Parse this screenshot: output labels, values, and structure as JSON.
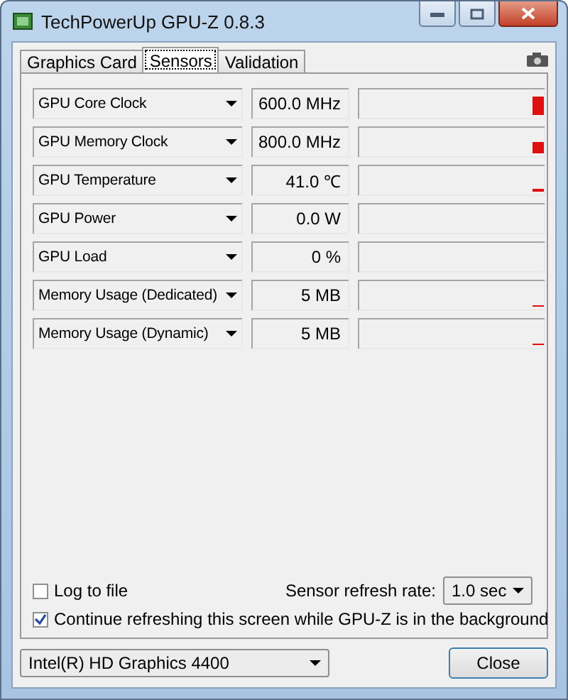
{
  "window": {
    "title": "TechPowerUp GPU-Z 0.8.3"
  },
  "tabs": [
    {
      "label": "Graphics Card",
      "selected": false
    },
    {
      "label": "Sensors",
      "selected": true
    },
    {
      "label": "Validation",
      "selected": false
    }
  ],
  "sensors": [
    {
      "name": "GPU Core Clock",
      "value": "600.0 MHz"
    },
    {
      "name": "GPU Memory Clock",
      "value": "800.0 MHz"
    },
    {
      "name": "GPU Temperature",
      "value": "41.0 ℃"
    },
    {
      "name": "GPU Power",
      "value": "0.0 W"
    },
    {
      "name": "GPU Load",
      "value": "0 %"
    },
    {
      "name": "Memory Usage (Dedicated)",
      "value": "5 MB"
    },
    {
      "name": "Memory Usage (Dynamic)",
      "value": "5 MB"
    }
  ],
  "log_to_file": {
    "label": "Log to file",
    "checked": false
  },
  "refresh_rate": {
    "label": "Sensor refresh rate:",
    "value": "1.0 sec"
  },
  "continue_refreshing": {
    "label": "Continue refreshing this screen while GPU-Z is in the background",
    "checked": true
  },
  "gpu_select": {
    "value": "Intel(R) HD Graphics 4400"
  },
  "buttons": [
    "Close"
  ]
}
